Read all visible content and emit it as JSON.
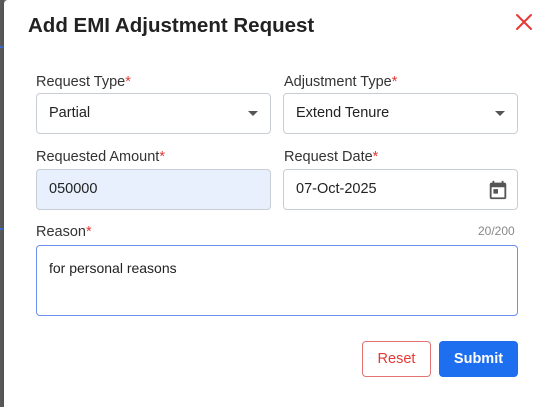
{
  "dialog": {
    "title": "Add EMI Adjustment Request",
    "required_marker": "*"
  },
  "form": {
    "request_type": {
      "label": "Request Type",
      "value": "Partial"
    },
    "adjustment_type": {
      "label": "Adjustment Type",
      "value": "Extend Tenure"
    },
    "requested_amount": {
      "label": "Requested Amount",
      "value": "050000"
    },
    "request_date": {
      "label": "Request Date",
      "value": "07-Oct-2025"
    },
    "reason": {
      "label": "Reason",
      "value": "for personal reasons",
      "counter": "20/200"
    }
  },
  "actions": {
    "reset_label": "Reset",
    "submit_label": "Submit"
  },
  "colors": {
    "primary": "#1e6ef0",
    "danger": "#e53935",
    "filled_bg": "#e8f0fe"
  }
}
